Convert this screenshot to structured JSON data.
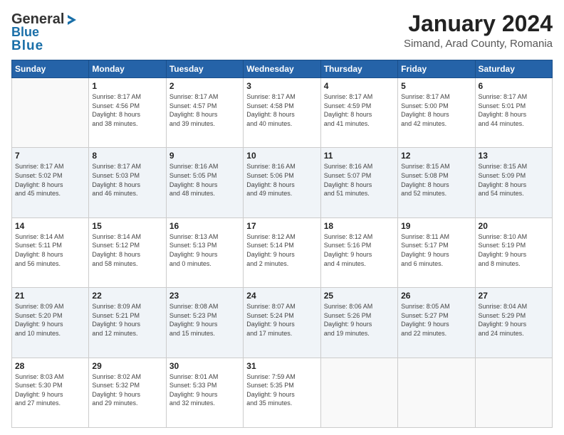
{
  "header": {
    "logo_general": "General",
    "logo_blue": "Blue",
    "title": "January 2024",
    "subtitle": "Simand, Arad County, Romania"
  },
  "days_of_week": [
    "Sunday",
    "Monday",
    "Tuesday",
    "Wednesday",
    "Thursday",
    "Friday",
    "Saturday"
  ],
  "weeks": [
    [
      {
        "day": "",
        "sunrise": "",
        "sunset": "",
        "daylight": ""
      },
      {
        "day": "1",
        "sunrise": "Sunrise: 8:17 AM",
        "sunset": "Sunset: 4:56 PM",
        "daylight": "Daylight: 8 hours and 38 minutes."
      },
      {
        "day": "2",
        "sunrise": "Sunrise: 8:17 AM",
        "sunset": "Sunset: 4:57 PM",
        "daylight": "Daylight: 8 hours and 39 minutes."
      },
      {
        "day": "3",
        "sunrise": "Sunrise: 8:17 AM",
        "sunset": "Sunset: 4:58 PM",
        "daylight": "Daylight: 8 hours and 40 minutes."
      },
      {
        "day": "4",
        "sunrise": "Sunrise: 8:17 AM",
        "sunset": "Sunset: 4:59 PM",
        "daylight": "Daylight: 8 hours and 41 minutes."
      },
      {
        "day": "5",
        "sunrise": "Sunrise: 8:17 AM",
        "sunset": "Sunset: 5:00 PM",
        "daylight": "Daylight: 8 hours and 42 minutes."
      },
      {
        "day": "6",
        "sunrise": "Sunrise: 8:17 AM",
        "sunset": "Sunset: 5:01 PM",
        "daylight": "Daylight: 8 hours and 44 minutes."
      }
    ],
    [
      {
        "day": "7",
        "sunrise": "Sunrise: 8:17 AM",
        "sunset": "Sunset: 5:02 PM",
        "daylight": "Daylight: 8 hours and 45 minutes."
      },
      {
        "day": "8",
        "sunrise": "Sunrise: 8:17 AM",
        "sunset": "Sunset: 5:03 PM",
        "daylight": "Daylight: 8 hours and 46 minutes."
      },
      {
        "day": "9",
        "sunrise": "Sunrise: 8:16 AM",
        "sunset": "Sunset: 5:05 PM",
        "daylight": "Daylight: 8 hours and 48 minutes."
      },
      {
        "day": "10",
        "sunrise": "Sunrise: 8:16 AM",
        "sunset": "Sunset: 5:06 PM",
        "daylight": "Daylight: 8 hours and 49 minutes."
      },
      {
        "day": "11",
        "sunrise": "Sunrise: 8:16 AM",
        "sunset": "Sunset: 5:07 PM",
        "daylight": "Daylight: 8 hours and 51 minutes."
      },
      {
        "day": "12",
        "sunrise": "Sunrise: 8:15 AM",
        "sunset": "Sunset: 5:08 PM",
        "daylight": "Daylight: 8 hours and 52 minutes."
      },
      {
        "day": "13",
        "sunrise": "Sunrise: 8:15 AM",
        "sunset": "Sunset: 5:09 PM",
        "daylight": "Daylight: 8 hours and 54 minutes."
      }
    ],
    [
      {
        "day": "14",
        "sunrise": "Sunrise: 8:14 AM",
        "sunset": "Sunset: 5:11 PM",
        "daylight": "Daylight: 8 hours and 56 minutes."
      },
      {
        "day": "15",
        "sunrise": "Sunrise: 8:14 AM",
        "sunset": "Sunset: 5:12 PM",
        "daylight": "Daylight: 8 hours and 58 minutes."
      },
      {
        "day": "16",
        "sunrise": "Sunrise: 8:13 AM",
        "sunset": "Sunset: 5:13 PM",
        "daylight": "Daylight: 9 hours and 0 minutes."
      },
      {
        "day": "17",
        "sunrise": "Sunrise: 8:12 AM",
        "sunset": "Sunset: 5:14 PM",
        "daylight": "Daylight: 9 hours and 2 minutes."
      },
      {
        "day": "18",
        "sunrise": "Sunrise: 8:12 AM",
        "sunset": "Sunset: 5:16 PM",
        "daylight": "Daylight: 9 hours and 4 minutes."
      },
      {
        "day": "19",
        "sunrise": "Sunrise: 8:11 AM",
        "sunset": "Sunset: 5:17 PM",
        "daylight": "Daylight: 9 hours and 6 minutes."
      },
      {
        "day": "20",
        "sunrise": "Sunrise: 8:10 AM",
        "sunset": "Sunset: 5:19 PM",
        "daylight": "Daylight: 9 hours and 8 minutes."
      }
    ],
    [
      {
        "day": "21",
        "sunrise": "Sunrise: 8:09 AM",
        "sunset": "Sunset: 5:20 PM",
        "daylight": "Daylight: 9 hours and 10 minutes."
      },
      {
        "day": "22",
        "sunrise": "Sunrise: 8:09 AM",
        "sunset": "Sunset: 5:21 PM",
        "daylight": "Daylight: 9 hours and 12 minutes."
      },
      {
        "day": "23",
        "sunrise": "Sunrise: 8:08 AM",
        "sunset": "Sunset: 5:23 PM",
        "daylight": "Daylight: 9 hours and 15 minutes."
      },
      {
        "day": "24",
        "sunrise": "Sunrise: 8:07 AM",
        "sunset": "Sunset: 5:24 PM",
        "daylight": "Daylight: 9 hours and 17 minutes."
      },
      {
        "day": "25",
        "sunrise": "Sunrise: 8:06 AM",
        "sunset": "Sunset: 5:26 PM",
        "daylight": "Daylight: 9 hours and 19 minutes."
      },
      {
        "day": "26",
        "sunrise": "Sunrise: 8:05 AM",
        "sunset": "Sunset: 5:27 PM",
        "daylight": "Daylight: 9 hours and 22 minutes."
      },
      {
        "day": "27",
        "sunrise": "Sunrise: 8:04 AM",
        "sunset": "Sunset: 5:29 PM",
        "daylight": "Daylight: 9 hours and 24 minutes."
      }
    ],
    [
      {
        "day": "28",
        "sunrise": "Sunrise: 8:03 AM",
        "sunset": "Sunset: 5:30 PM",
        "daylight": "Daylight: 9 hours and 27 minutes."
      },
      {
        "day": "29",
        "sunrise": "Sunrise: 8:02 AM",
        "sunset": "Sunset: 5:32 PM",
        "daylight": "Daylight: 9 hours and 29 minutes."
      },
      {
        "day": "30",
        "sunrise": "Sunrise: 8:01 AM",
        "sunset": "Sunset: 5:33 PM",
        "daylight": "Daylight: 9 hours and 32 minutes."
      },
      {
        "day": "31",
        "sunrise": "Sunrise: 7:59 AM",
        "sunset": "Sunset: 5:35 PM",
        "daylight": "Daylight: 9 hours and 35 minutes."
      },
      {
        "day": "",
        "sunrise": "",
        "sunset": "",
        "daylight": ""
      },
      {
        "day": "",
        "sunrise": "",
        "sunset": "",
        "daylight": ""
      },
      {
        "day": "",
        "sunrise": "",
        "sunset": "",
        "daylight": ""
      }
    ]
  ]
}
